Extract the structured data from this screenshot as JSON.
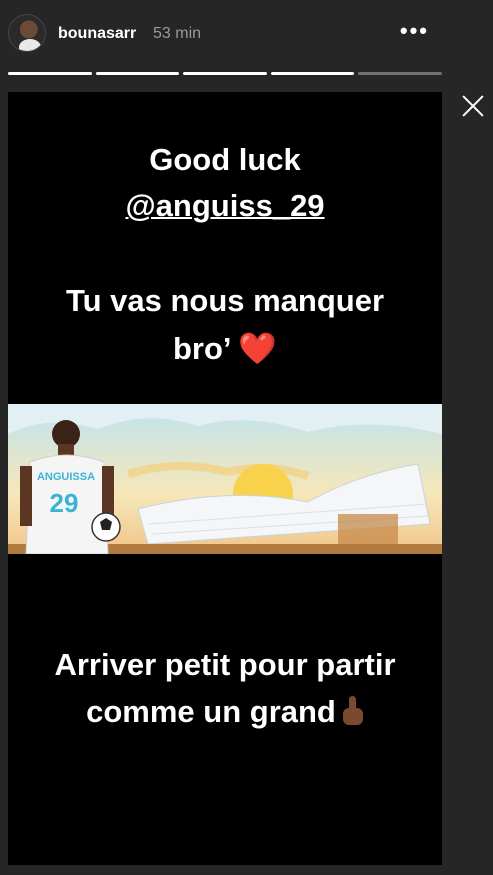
{
  "header": {
    "username": "bounasarr",
    "time": "53 min",
    "more": "•••",
    "progress_total": 5,
    "progress_done": 4
  },
  "story": {
    "line1": "Good luck",
    "mention": "@anguiss_29",
    "line3": "Tu vas nous manquer",
    "line4_text": "bro’ ",
    "heart": "❤️",
    "line5": "Arriver petit pour partir",
    "line6": "comme un grand",
    "illustration": {
      "jersey_name": "ANGUISSA",
      "jersey_number": "29"
    }
  },
  "colors": {
    "background": "#262626",
    "story_bg": "#000000",
    "sky": "#cfe9f2",
    "sun": "#f7d24a",
    "stadium": "#f4f6f8"
  }
}
